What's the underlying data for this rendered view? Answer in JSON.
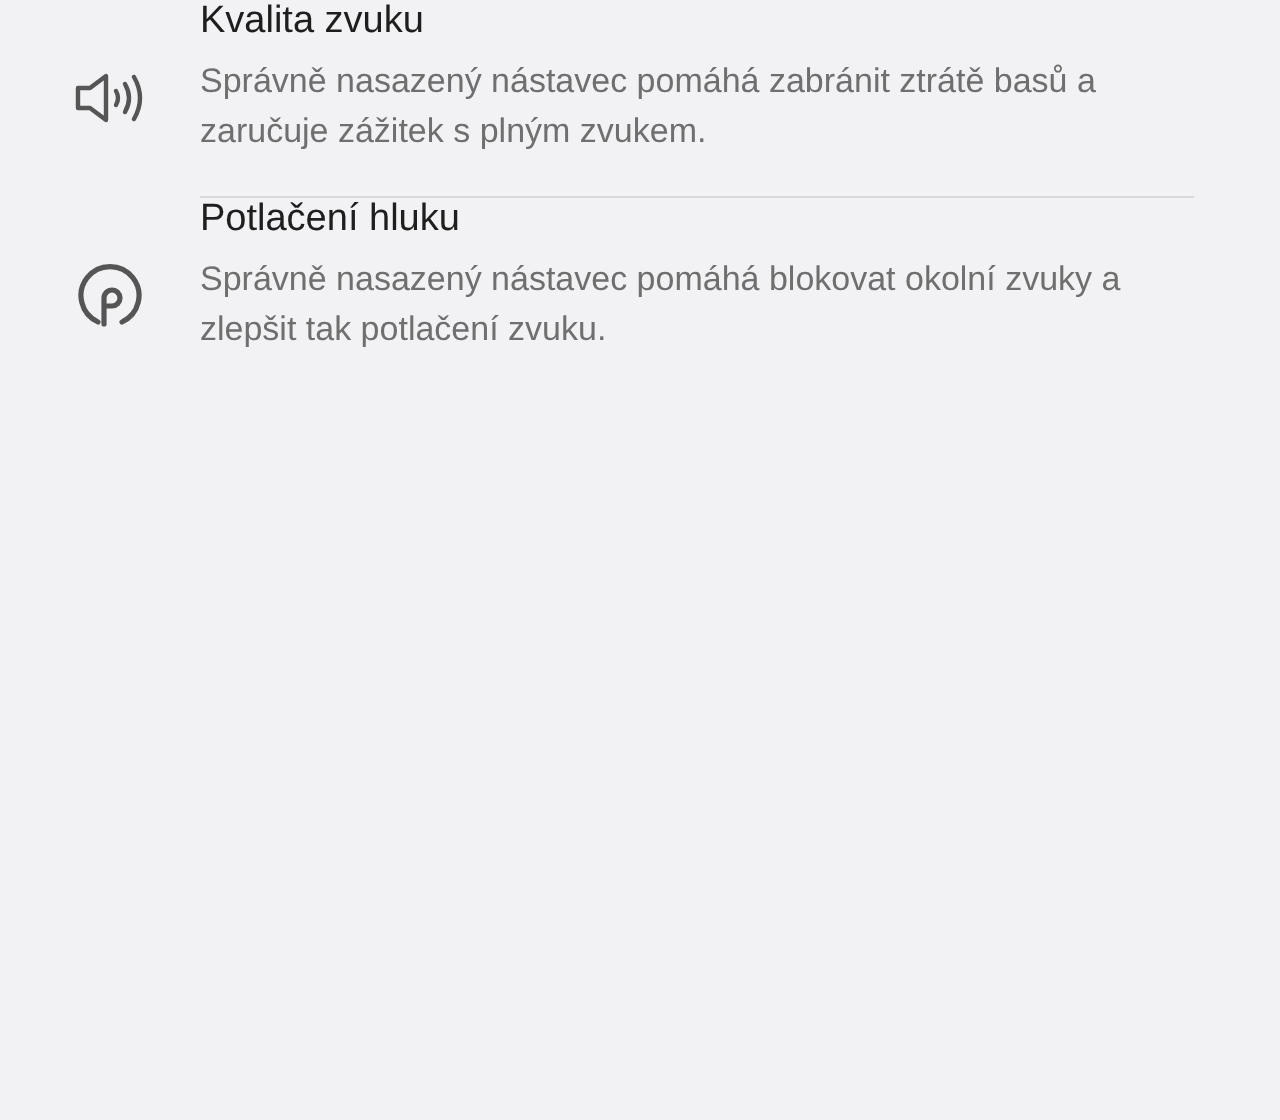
{
  "items": [
    {
      "kind": "sound",
      "title": "Kvalita zvuku",
      "description": "Správně nasazený nástavec pomáhá zabránit ztrátě basů a zaručuje zážitek s plným zvukem."
    },
    {
      "kind": "noise",
      "title": "Potlačení hluku",
      "description": "Správně nasazený nástavec pomáhá blokovat okolní zvuky a zlepšit tak potlačení zvuku."
    }
  ]
}
